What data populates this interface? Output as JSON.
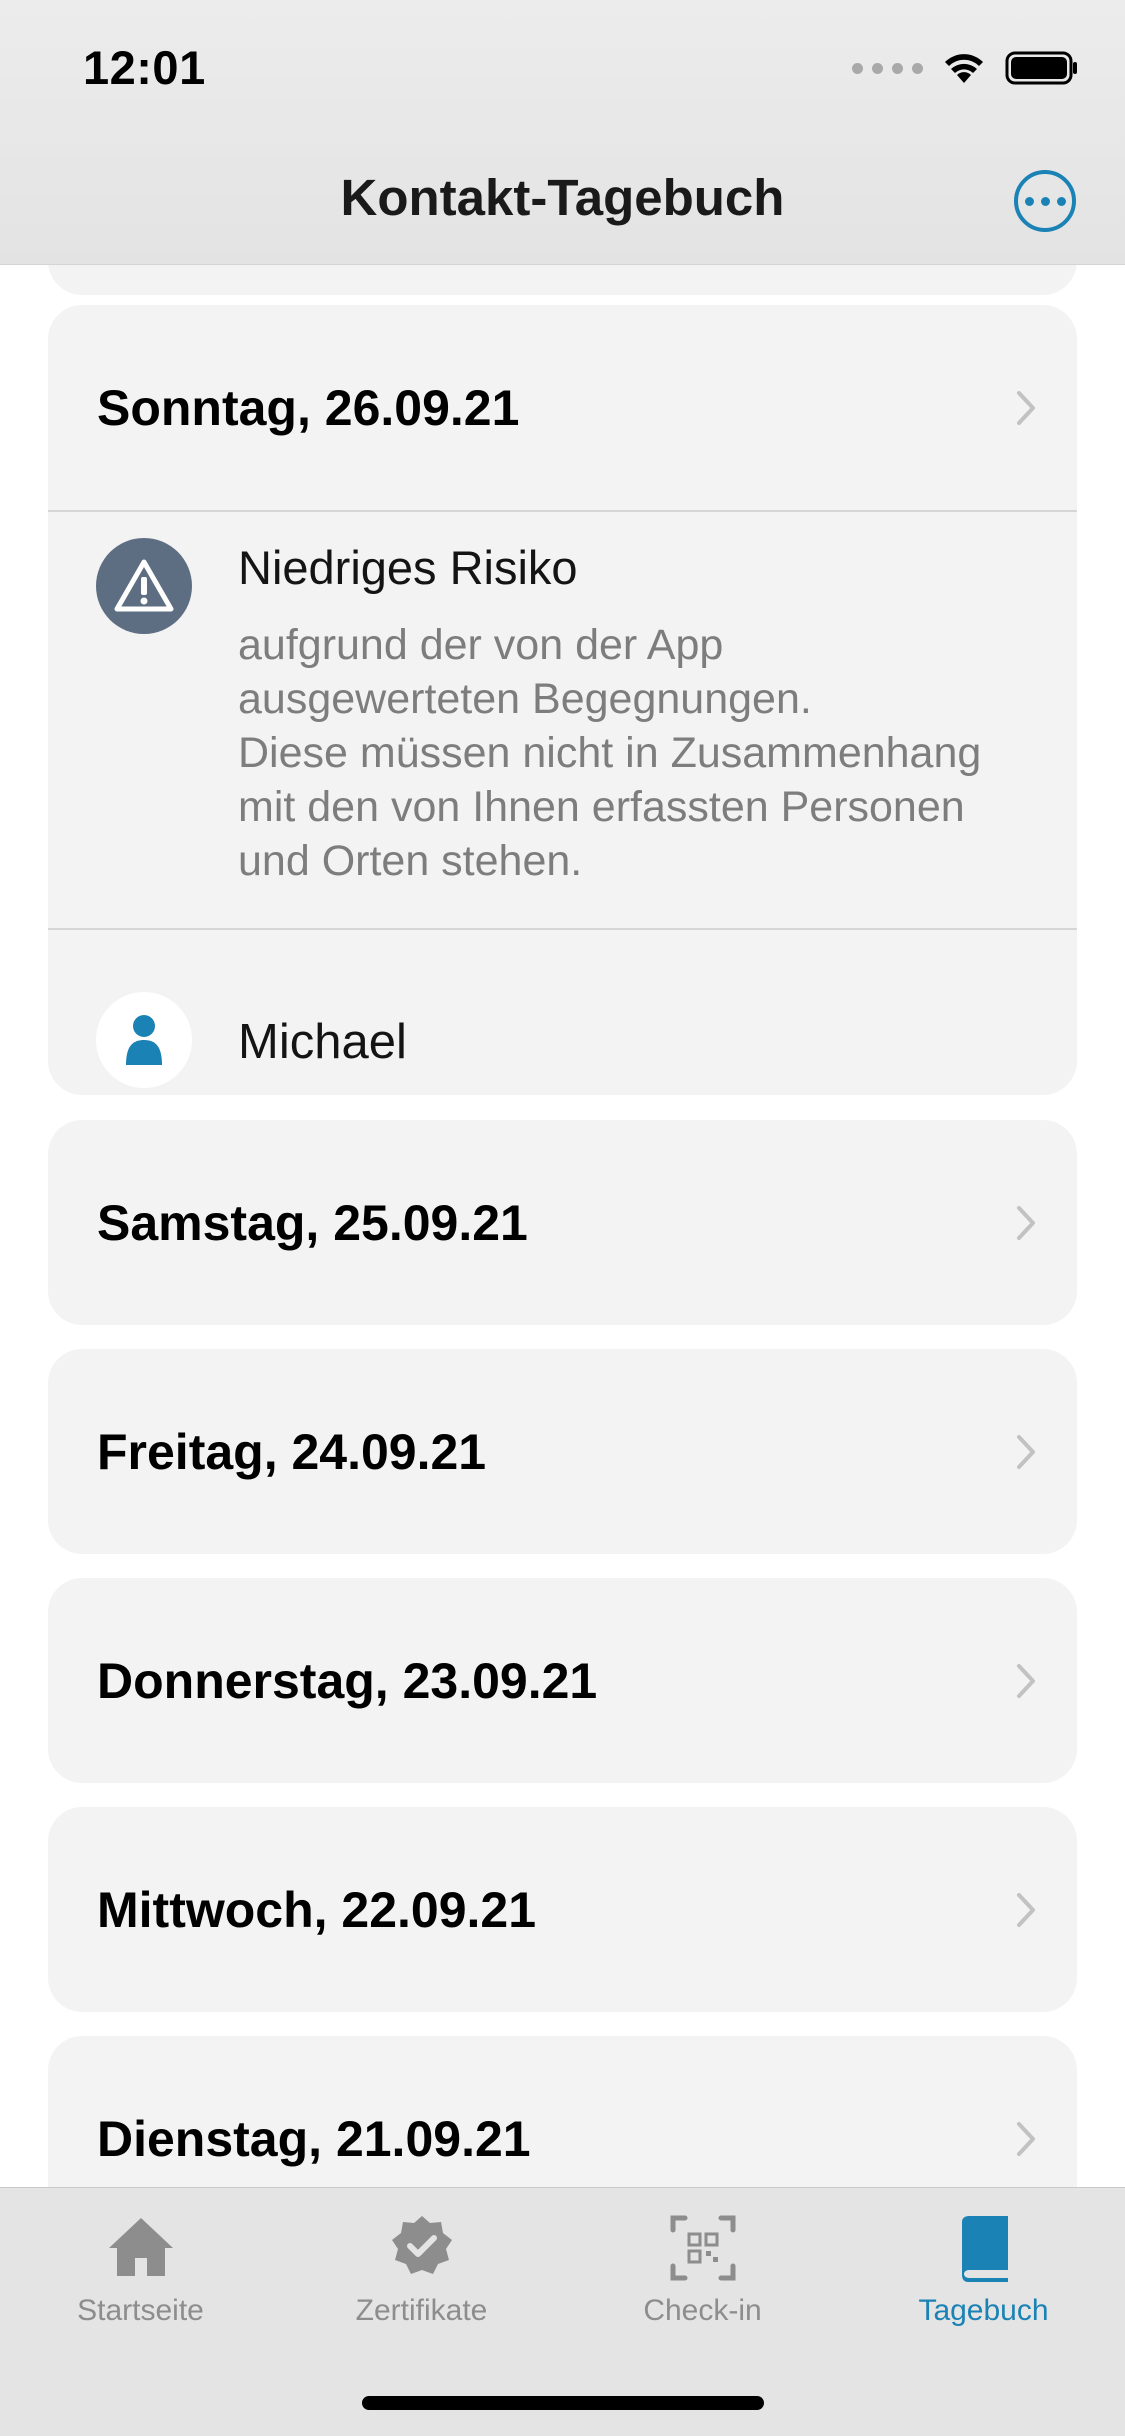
{
  "status_bar": {
    "time": "12:01"
  },
  "nav": {
    "title": "Kontakt-Tagebuch"
  },
  "entries": {
    "first_day": {
      "date_label": "Sonntag, 26.09.21",
      "risk_title": "Niedriges Risiko",
      "risk_description": "aufgrund der von der App\nausgewerteten Begegnungen.\nDiese müssen nicht in Zusammenhang\nmit den von Ihnen erfassten Personen\nund Orten stehen.",
      "person_name": "Michael"
    },
    "days": [
      {
        "date_label": "Samstag, 25.09.21"
      },
      {
        "date_label": "Freitag, 24.09.21"
      },
      {
        "date_label": "Donnerstag, 23.09.21"
      },
      {
        "date_label": "Mittwoch, 22.09.21"
      },
      {
        "date_label": "Dienstag, 21.09.21"
      }
    ]
  },
  "tabbar": {
    "tabs": [
      {
        "label": "Startseite",
        "icon": "home-icon"
      },
      {
        "label": "Zertifikate",
        "icon": "certificate-badge-icon"
      },
      {
        "label": "Check-in",
        "icon": "qr-scan-icon"
      },
      {
        "label": "Tagebuch",
        "icon": "book-icon",
        "active": true
      }
    ]
  },
  "colors": {
    "accent": "#1a82b4",
    "risk_icon_bg": "#5e6e82",
    "card_bg": "#f3f3f3",
    "inactive_tab": "#8d8d8d"
  }
}
